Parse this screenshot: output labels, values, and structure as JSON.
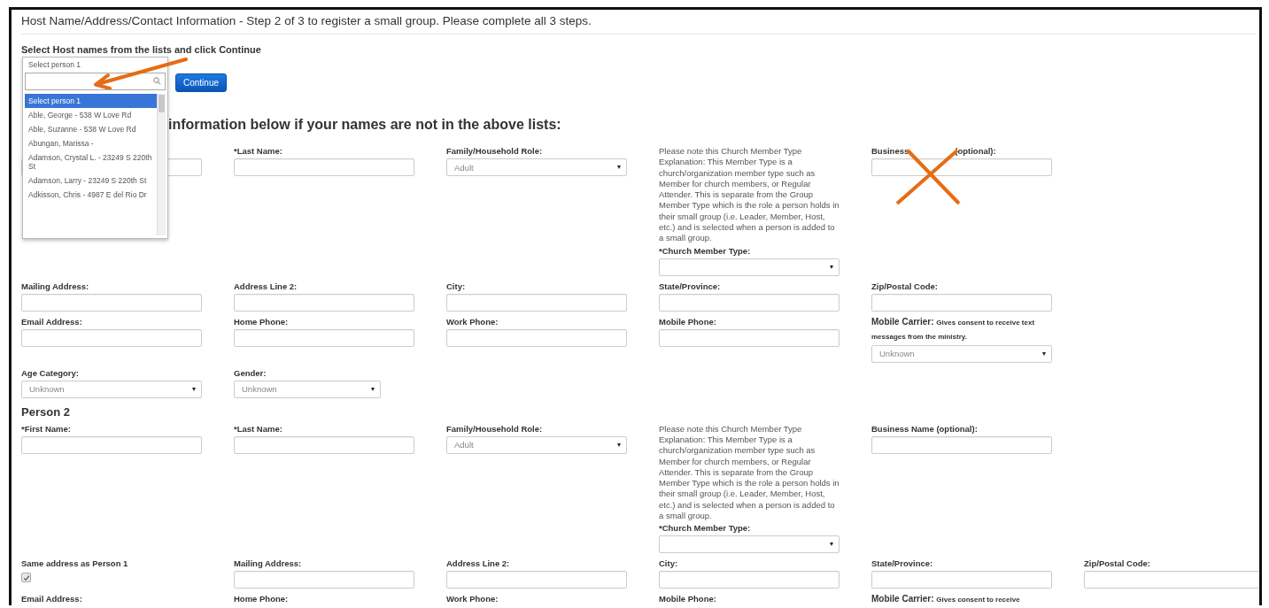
{
  "page_title": "Host Name/Address/Contact Information - Step 2 of 3 to register a small group. Please complete all 3 steps.",
  "select_heading": "Select Host names from the lists and click Continue",
  "person_select": {
    "value": "Select person 1",
    "options": [
      {
        "label": "Select person 1",
        "selected": true
      },
      {
        "label": "Able, George - 538 W Love Rd",
        "selected": false
      },
      {
        "label": "Able, Suzanne - 538 W Love Rd",
        "selected": false
      },
      {
        "label": "Abungan, Marissa -",
        "selected": false
      },
      {
        "label": "Adamson, Crystal L. - 23249 S 220th St",
        "selected": false
      },
      {
        "label": "Adamson, Larry - 23249 S 220th St",
        "selected": false
      },
      {
        "label": "Adkisson, Chris - 4987 E del Rio Dr",
        "selected": false
      }
    ]
  },
  "continue_button": "Continue",
  "info_heading": "information below if your names are not in the above lists:",
  "persons": [
    {
      "rows": [
        [
          {
            "kind": "input"
          },
          {
            "kind": "input",
            "label": "*Last Name:"
          },
          {
            "kind": "select",
            "label": "Family/Household Role:",
            "value": "Adult"
          },
          {
            "kind": "church",
            "note": "Please note this Church Member Type Explanation:  This Member Type is a church/organization member type such as Member for church members, or Regular Attender. This is separate from the Group Member Type which is the role a person holds in their small group (i.e. Leader, Member, Host, etc.) and is selected when a person is added to a small group.",
            "label": "*Church Member Type:"
          },
          {
            "kind": "input",
            "label": "Business",
            "label_tail": "(optional):"
          }
        ],
        [
          {
            "kind": "input",
            "label": "Mailing Address:"
          },
          {
            "kind": "input",
            "label": "Address Line 2:"
          },
          {
            "kind": "input",
            "label": "City:"
          },
          {
            "kind": "input",
            "label": "State/Province:"
          },
          {
            "kind": "input",
            "label": "Zip/Postal Code:"
          }
        ],
        [
          {
            "kind": "input",
            "label": "Email Address:"
          },
          {
            "kind": "input",
            "label": "Home Phone:"
          },
          {
            "kind": "input",
            "label": "Work Phone:"
          },
          {
            "kind": "input",
            "label": "Mobile Phone:"
          },
          {
            "kind": "carrier",
            "label": "Mobile Carrier:",
            "hint": "Gives consent to receive text messages from the ministry.",
            "value": "Unknown"
          }
        ],
        [
          {
            "kind": "select",
            "label": "Age Category:",
            "value": "Unknown"
          },
          {
            "kind": "select",
            "label": "Gender:",
            "value": "Unknown"
          }
        ]
      ]
    },
    {
      "heading": "Person 2",
      "rows": [
        [
          {
            "kind": "input",
            "label": "*First Name:"
          },
          {
            "kind": "input",
            "label": "*Last Name:"
          },
          {
            "kind": "select",
            "label": "Family/Household Role:",
            "value": "Adult"
          },
          {
            "kind": "church",
            "note": "Please note this Church Member Type Explanation:  This Member Type is a church/organization member type such as Member for church members, or Regular Attender. This is separate from the Group Member Type which is the role a person holds in their small group (i.e. Leader, Member, Host, etc.) and is selected when a person is added to a small group.",
            "label": "*Church Member Type:"
          },
          {
            "kind": "input",
            "label": "Business Name (optional):"
          }
        ],
        [
          {
            "kind": "checkbox",
            "label": "Same address as Person 1",
            "checked": true
          },
          {
            "kind": "input",
            "label": "Mailing Address:"
          },
          {
            "kind": "input",
            "label": "Address Line 2:"
          },
          {
            "kind": "input",
            "label": "City:"
          },
          {
            "kind": "input",
            "label": "State/Province:"
          },
          {
            "kind": "input",
            "label": "Zip/Postal Code:"
          }
        ],
        [
          {
            "kind": "label",
            "label": "Email Address:"
          },
          {
            "kind": "label",
            "label": "Home Phone:"
          },
          {
            "kind": "label",
            "label": "Work Phone:"
          },
          {
            "kind": "label",
            "label": "Mobile Phone:"
          },
          {
            "kind": "carrier_label",
            "label": "Mobile Carrier:",
            "hint": "Gives consent to receive"
          }
        ]
      ]
    }
  ]
}
